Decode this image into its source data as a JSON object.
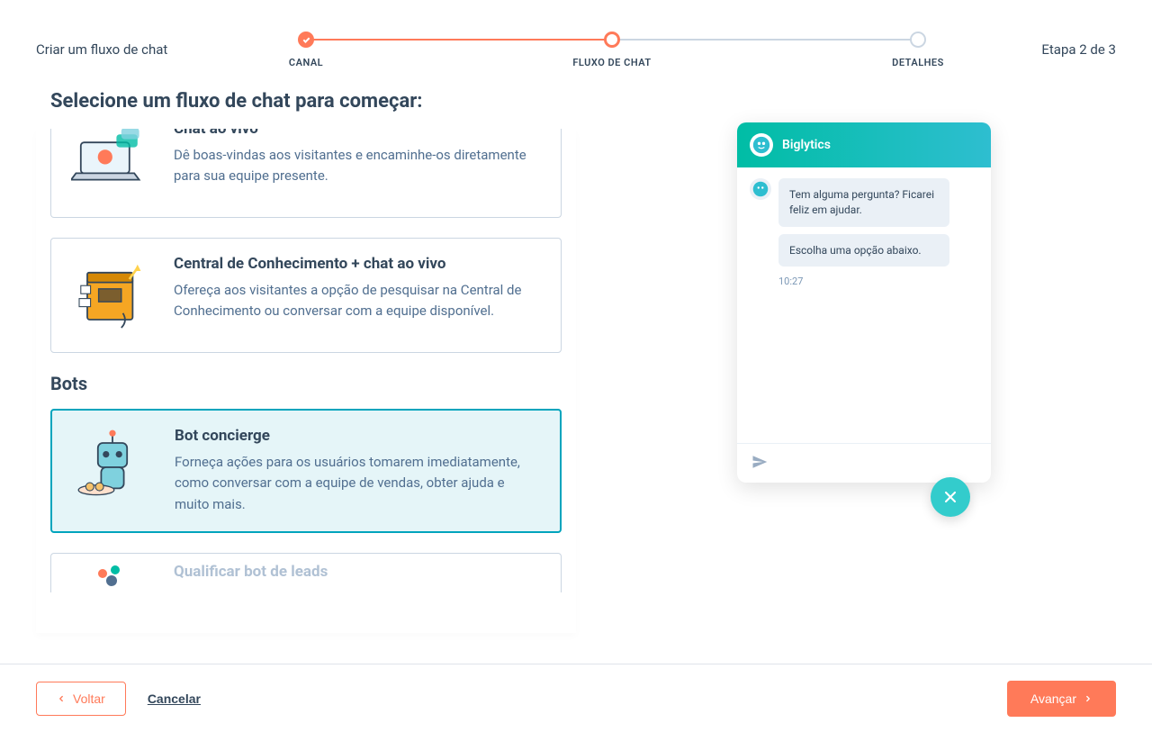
{
  "header": {
    "title": "Criar um fluxo de chat",
    "step_indicator": "Etapa 2 de 3"
  },
  "stepper": {
    "steps": [
      {
        "label": "CANAL",
        "state": "done"
      },
      {
        "label": "FLUXO DE CHAT",
        "state": "current"
      },
      {
        "label": "DETALHES",
        "state": "upcoming"
      }
    ]
  },
  "page": {
    "title": "Selecione um fluxo de chat para começar:"
  },
  "sections": {
    "bots_heading": "Bots"
  },
  "options": {
    "live_chat": {
      "title": "Chat ao vivo",
      "desc": "Dê boas-vindas aos visitantes e encaminhe-os diretamente para sua equipe presente."
    },
    "kb_live_chat": {
      "title": "Central de Conhecimento + chat ao vivo",
      "desc": "Ofereça aos visitantes a opção de pesquisar na Central de Conhecimento ou conversar com a equipe disponível."
    },
    "bot_concierge": {
      "title": "Bot concierge",
      "desc": "Forneça ações para os usuários tomarem imediatamente, como conversar com a equipe de vendas, obter ajuda e muito mais.",
      "selected": true
    },
    "qualify_leads": {
      "title": "Qualificar bot de leads"
    }
  },
  "chat_preview": {
    "brand": "Biglytics",
    "messages": [
      "Tem alguma pergunta? Ficarei feliz em ajudar.",
      "Escolha uma opção abaixo."
    ],
    "timestamp": "10:27"
  },
  "footer": {
    "back": "Voltar",
    "cancel": "Cancelar",
    "next": "Avançar"
  }
}
